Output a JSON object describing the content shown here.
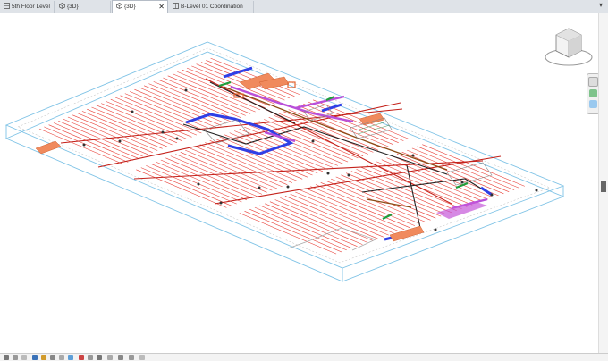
{
  "tabs": [
    {
      "label": "5th Floor Level",
      "active": false,
      "closable": false
    },
    {
      "label": "{3D}",
      "active": false,
      "closable": false
    },
    {
      "label": "{3D}",
      "active": true,
      "closable": true
    },
    {
      "label": "B-Level 01 Coordination",
      "active": false,
      "closable": false
    }
  ],
  "tab_close_glyph": "✕",
  "tab_menu_glyph": "▾",
  "icons": {
    "floor_plan": "floor-plan-icon",
    "view_3d": "3d-view-icon",
    "sheet": "sheet-icon",
    "viewcube": "viewcube-icon",
    "steering_wheel": "steering-wheel-icon",
    "zoom": "zoom-icon"
  },
  "colors": {
    "boundary": "#7fc3e6",
    "sprinkler_pipe": "#e8423a",
    "main_pipe": "#c4221b",
    "duct_blue": "#2f3fe6",
    "duct_purple": "#b94fd9",
    "duct_orange": "#f08a5d",
    "pipe_green": "#1f9e3c",
    "structure_dark": "#222222",
    "pipe_brown": "#8b4c16"
  }
}
